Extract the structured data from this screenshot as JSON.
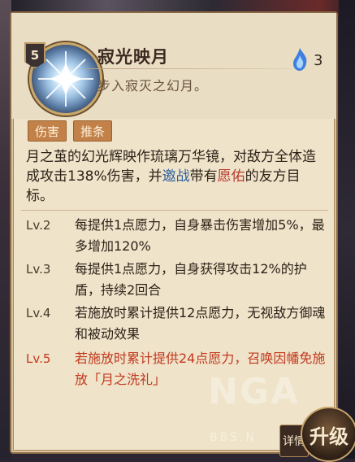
{
  "skill": {
    "level": "5",
    "name": "寂光映月",
    "subtitle": "步入寂灭之幻月。",
    "cost": "3",
    "icon": "moon-crystal-icon",
    "fire_icon": "blue-fire-icon"
  },
  "tags": [
    "伤害",
    "推条"
  ],
  "description": {
    "part1": "月之茧的幻光辉映作琉璃万华镜，对敌方全体造成攻击138%伤害，并",
    "kw_invite": "邀战",
    "part2": "带有",
    "kw_bless": "愿佑",
    "part3": "的友方目标。"
  },
  "levels": [
    {
      "label": "Lv.2",
      "text": "每提供1点愿力，自身暴击伤害增加5%，最多增加120%"
    },
    {
      "label": "Lv.3",
      "text": "每提供1点愿力，自身获得攻击12%的护盾，持续2回合"
    },
    {
      "label": "Lv.4",
      "text": "若施放时累计提供12点愿力，无视敌方御魂和被动效果"
    },
    {
      "label": "Lv.5",
      "text": "若施放时累计提供24点愿力，召唤因幡免施放「月之洗礼」"
    }
  ],
  "buttons": {
    "upgrade": "升级",
    "detail": "详情"
  },
  "watermark": {
    "logo": "NGA",
    "site": "BBS.N"
  },
  "colors": {
    "panel_bg": "#efe3c9",
    "tag_bg": "#c28148",
    "highlight_red": "#c2391f",
    "keyword_blue": "#2c5f9e"
  }
}
